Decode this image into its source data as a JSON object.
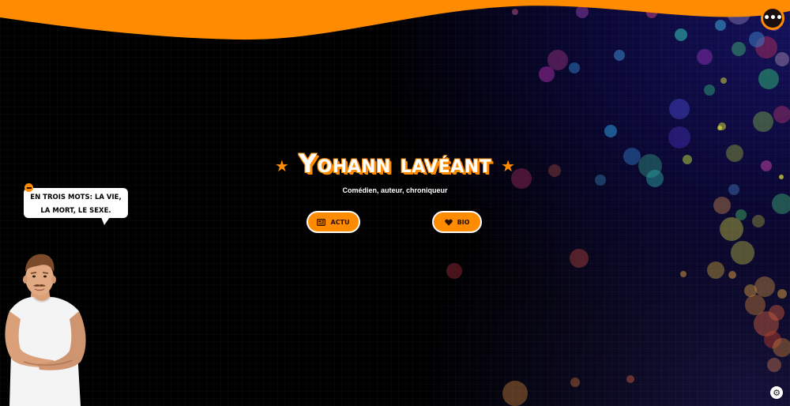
{
  "header": {
    "menu_icon": "more-horizontal-icon",
    "menu_glyph": "•••",
    "wave_color": "#ff8c00"
  },
  "hero": {
    "title": "Yohann lavéant",
    "subtitle": "Comédien, auteur, chroniqueur",
    "star_icon": "star-icon",
    "star_glyph": "★"
  },
  "nav": {
    "buttons": [
      {
        "label": "ACTU",
        "icon": "newspaper-icon"
      },
      {
        "label": "BIO",
        "icon": "heart-icon"
      }
    ]
  },
  "bubble": {
    "text": "EN TROIS MOTS: LA VIE, LA MORT, LE SEXE.",
    "minimize_icon": "minus-icon"
  },
  "footer": {
    "settings_icon": "gear-icon",
    "settings_glyph": "⚙"
  },
  "colors": {
    "accent": "#ff8c00",
    "background": "#000000",
    "deep_blue": "#14105a",
    "text": "#ffffff"
  }
}
